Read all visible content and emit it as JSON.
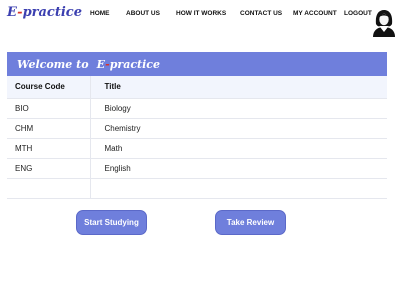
{
  "app": {
    "logo_first": "E",
    "logo_dash": "-",
    "logo_rest": "practice"
  },
  "nav": {
    "items": [
      {
        "label": "HOME"
      },
      {
        "label": "ABOUT US"
      },
      {
        "label": "HOW IT WORKS"
      },
      {
        "label": "CONTACT US"
      },
      {
        "label": "MY ACCOUNT"
      },
      {
        "label": "LOGOUT"
      }
    ],
    "avatar_icon": "user-avatar-icon"
  },
  "banner": {
    "welcome": "Welcome to",
    "brand_first": "E",
    "brand_mark": "-",
    "brand_rest": "practice"
  },
  "table": {
    "headers": [
      "Course Code",
      "Title"
    ],
    "rows": [
      [
        "BIO",
        "Biology"
      ],
      [
        "CHM",
        "Chemistry"
      ],
      [
        "MTH",
        "Math"
      ],
      [
        "ENG",
        "English"
      ]
    ]
  },
  "actions": {
    "start_label": "Start Studying",
    "review_label": "Take Review"
  },
  "colors": {
    "accent": "#6f7fdc",
    "logo": "#3b3fb0",
    "logo_dash": "#d9342b"
  }
}
